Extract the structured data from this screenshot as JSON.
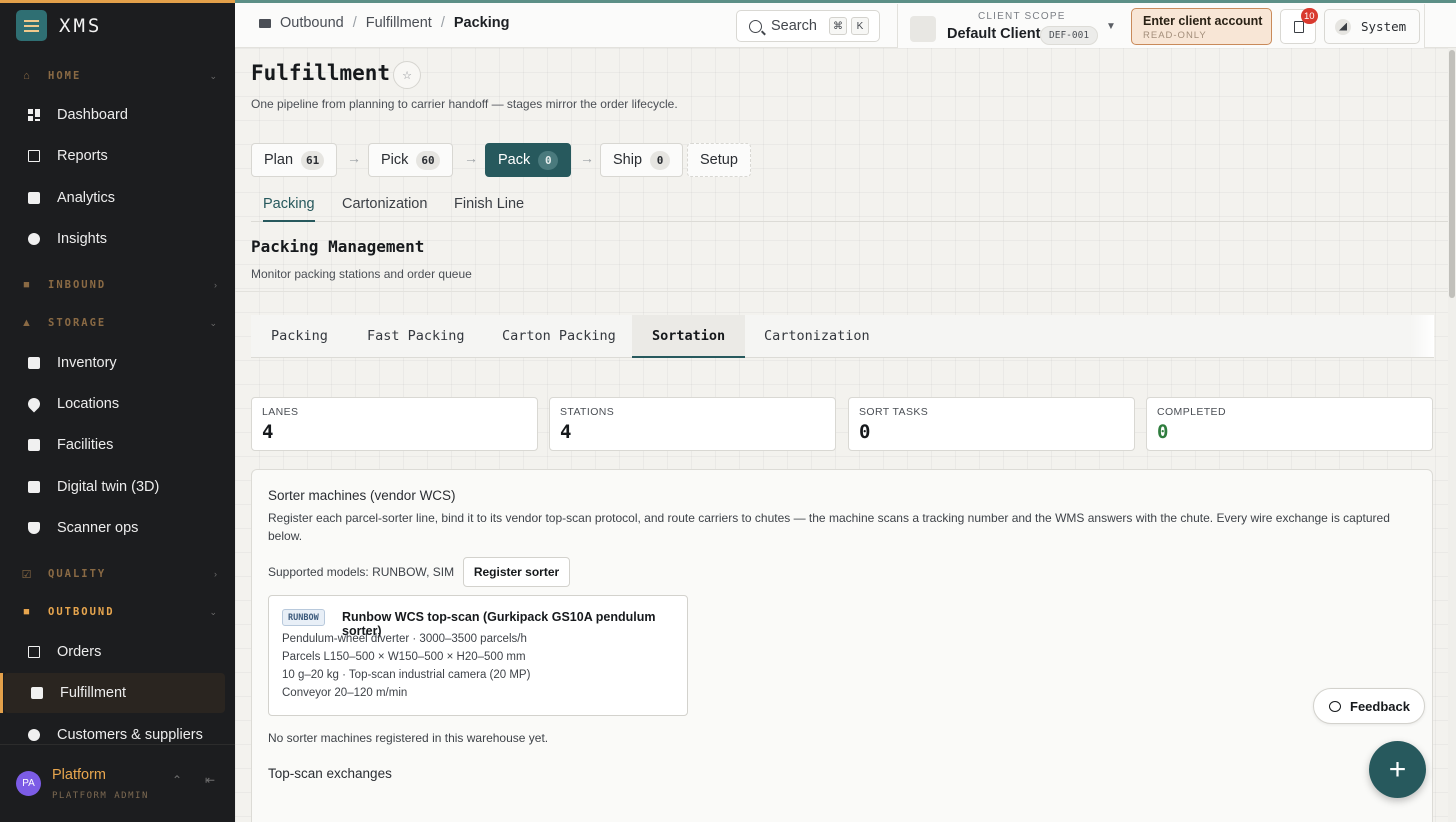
{
  "app": {
    "name": "XMS"
  },
  "sidebar": {
    "sections": [
      {
        "label": "HOME",
        "icon": "home-icon",
        "expanded": true,
        "items": [
          {
            "label": "Dashboard",
            "icon": "dashboard-icon"
          },
          {
            "label": "Reports",
            "icon": "report-icon"
          },
          {
            "label": "Analytics",
            "icon": "analytics-icon"
          },
          {
            "label": "Insights",
            "icon": "globe-icon"
          }
        ]
      },
      {
        "label": "INBOUND",
        "icon": "truck-icon",
        "expanded": false,
        "items": []
      },
      {
        "label": "STORAGE",
        "icon": "warehouse-icon",
        "expanded": true,
        "items": [
          {
            "label": "Inventory",
            "icon": "inventory-icon"
          },
          {
            "label": "Locations",
            "icon": "pin-icon"
          },
          {
            "label": "Facilities",
            "icon": "facility-icon"
          },
          {
            "label": "Digital twin (3D)",
            "icon": "twin-icon"
          },
          {
            "label": "Scanner ops",
            "icon": "shield-icon"
          }
        ]
      },
      {
        "label": "QUALITY",
        "icon": "check-icon",
        "expanded": false,
        "items": []
      },
      {
        "label": "OUTBOUND",
        "icon": "truck-icon",
        "expanded": true,
        "active": true,
        "items": [
          {
            "label": "Orders",
            "icon": "doc-icon"
          },
          {
            "label": "Fulfillment",
            "icon": "truck-icon",
            "active": true
          },
          {
            "label": "Customers & suppliers",
            "icon": "people-icon"
          }
        ]
      }
    ],
    "user": {
      "initials": "PA",
      "name": "Platform",
      "role": "PLATFORM ADMIN"
    }
  },
  "topbar": {
    "breadcrumb": [
      "Outbound",
      "Fulfillment",
      "Packing"
    ],
    "search": {
      "label": "Search",
      "keys": [
        "⌘",
        "K"
      ]
    },
    "scope": {
      "label": "CLIENT SCOPE",
      "value": "Default Client",
      "code": "DEF-001"
    },
    "enter_client": {
      "title": "Enter client account",
      "subtitle": "READ-ONLY"
    },
    "notifications": {
      "count": "10"
    },
    "system_label": "System"
  },
  "page": {
    "title": "Fulfillment",
    "subtitle": "One pipeline from planning to carrier handoff — stages mirror the order lifecycle.",
    "stages": [
      {
        "label": "Plan",
        "count": "61"
      },
      {
        "label": "Pick",
        "count": "60"
      },
      {
        "label": "Pack",
        "count": "0",
        "active": true
      },
      {
        "label": "Ship",
        "count": "0"
      },
      {
        "label": "Setup"
      }
    ],
    "subtabs": [
      "Packing",
      "Cartonization",
      "Finish Line"
    ],
    "section_title": "Packing Management",
    "section_subtitle": "Monitor packing stations and order queue",
    "tabs": [
      "Packing",
      "Fast Packing",
      "Carton Packing",
      "Sortation",
      "Cartonization"
    ],
    "active_tab": "Sortation",
    "stats": [
      {
        "label": "LANES",
        "value": "4"
      },
      {
        "label": "STATIONS",
        "value": "4"
      },
      {
        "label": "SORT TASKS",
        "value": "0"
      },
      {
        "label": "COMPLETED",
        "value": "0",
        "color": "#2f7d3e"
      }
    ],
    "sorter": {
      "title": "Sorter machines (vendor WCS)",
      "description": "Register each parcel-sorter line, bind it to its vendor top-scan protocol, and route carriers to chutes — the machine scans a tracking number and the WMS answers with the chute. Every wire exchange is captured below.",
      "supported_models": "Supported models: RUNBOW, SIM",
      "register_label": "Register sorter",
      "model_card": {
        "tag": "RUNBOW",
        "title": "Runbow WCS top-scan (Gurkipack GS10A pendulum sorter)",
        "lines": [
          "Pendulum-wheel diverter · 3000–3500 parcels/h",
          "Parcels L150–500 × W150–500 × H20–500 mm",
          "10 g–20 kg · Top-scan industrial camera (20 MP)",
          "Conveyor 20–120 m/min"
        ]
      },
      "empty_text": "No sorter machines registered in this warehouse yet.",
      "exchanges_title": "Top-scan exchanges"
    },
    "feedback_label": "Feedback",
    "fab_label": "+"
  },
  "colors": {
    "accent": "#27595d",
    "sidebar_accent": "#e3a04a",
    "badge": "#d93a2f"
  }
}
